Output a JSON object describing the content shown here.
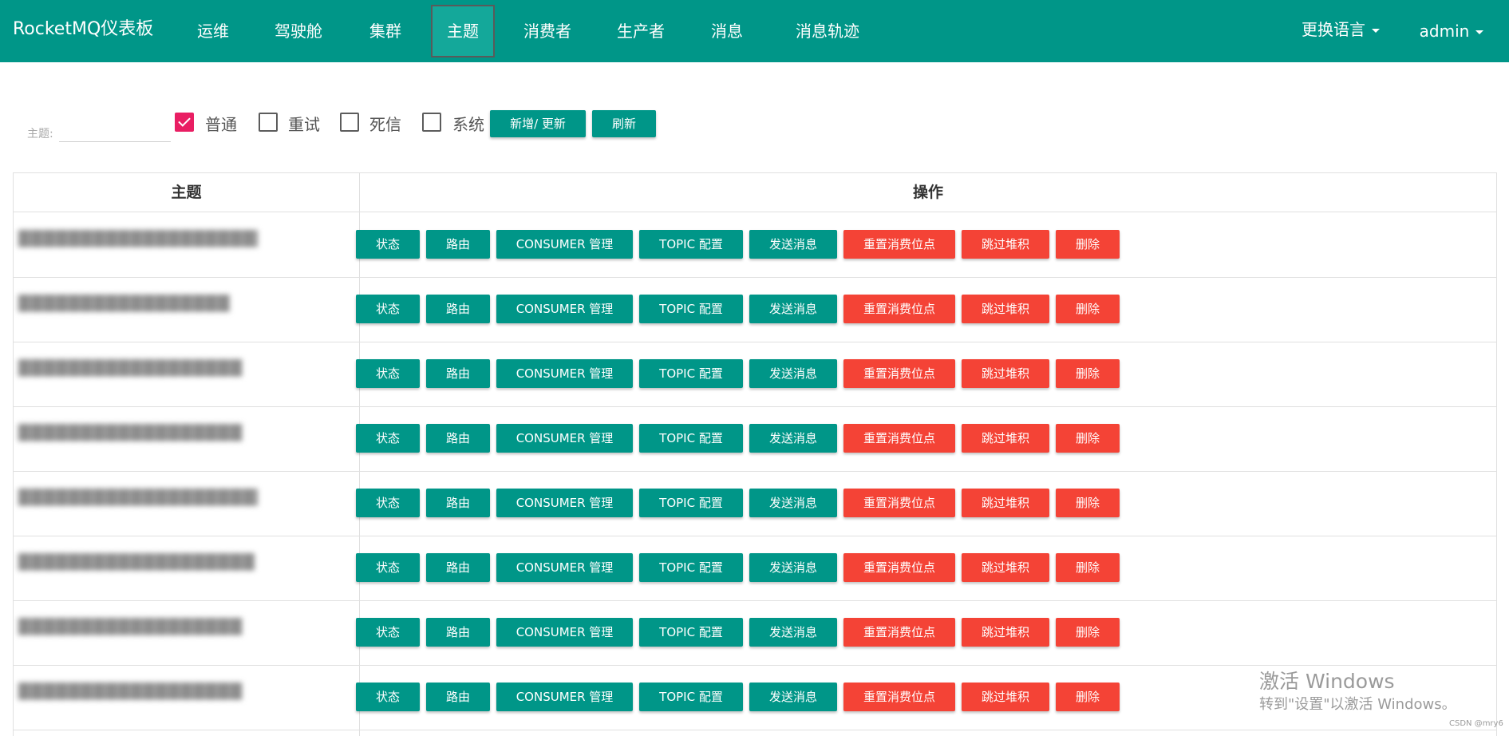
{
  "nav": {
    "brand": "RocketMQ仪表板",
    "items": [
      {
        "label": "运维"
      },
      {
        "label": "驾驶舱"
      },
      {
        "label": "集群"
      },
      {
        "label": "主题"
      },
      {
        "label": "消费者"
      },
      {
        "label": "生产者"
      },
      {
        "label": "消息"
      },
      {
        "label": "消息轨迹"
      }
    ],
    "language_label": "更换语言",
    "user_label": "admin"
  },
  "filter": {
    "topic_label": "主题:",
    "topic_value": "",
    "checkboxes": [
      {
        "label": "普通",
        "checked": true
      },
      {
        "label": "重试",
        "checked": false
      },
      {
        "label": "死信",
        "checked": false
      },
      {
        "label": "系统",
        "checked": false
      }
    ],
    "add_update_label": "新增/ 更新",
    "refresh_label": "刷新"
  },
  "table": {
    "headers": [
      "主题",
      "操作"
    ],
    "actions": [
      {
        "label": "状态",
        "color": "teal"
      },
      {
        "label": "路由",
        "color": "teal"
      },
      {
        "label": "CONSUMER 管理",
        "color": "teal"
      },
      {
        "label": "TOPIC 配置",
        "color": "teal"
      },
      {
        "label": "发送消息",
        "color": "teal"
      },
      {
        "label": "重置消费位点",
        "color": "red"
      },
      {
        "label": "跳过堆积",
        "color": "red"
      },
      {
        "label": "删除",
        "color": "red"
      }
    ],
    "rows": [
      {
        "topic": "████████████████████"
      },
      {
        "topic": "█████████████████"
      },
      {
        "topic": "██████████████████"
      },
      {
        "topic": "██████████████████"
      },
      {
        "topic": "████████████████████"
      },
      {
        "topic": "███████████████████"
      },
      {
        "topic": "██████████████████"
      },
      {
        "topic": "██████████████████"
      }
    ]
  },
  "watermark": {
    "title": "激活 Windows",
    "subtitle": "转到\"设置\"以激活 Windows。",
    "credit": "CSDN @mry6"
  },
  "colors": {
    "primary": "#009688",
    "danger": "#f44336",
    "checkbox_checked": "#e91e63"
  }
}
